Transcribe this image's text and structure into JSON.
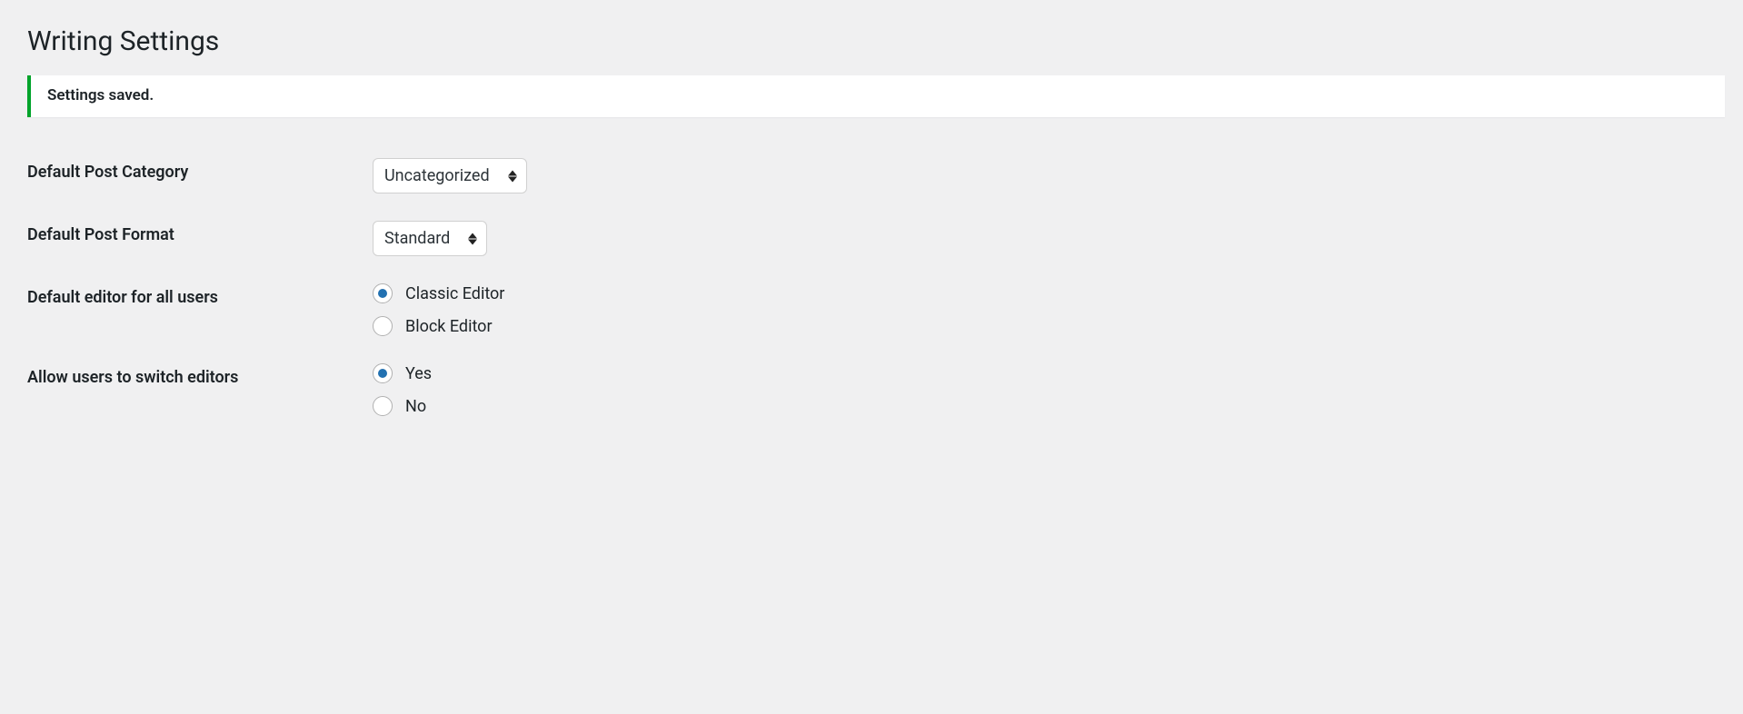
{
  "page_title": "Writing Settings",
  "notice": "Settings saved.",
  "fields": {
    "default_post_category": {
      "label": "Default Post Category",
      "value": "Uncategorized"
    },
    "default_post_format": {
      "label": "Default Post Format",
      "value": "Standard"
    },
    "default_editor": {
      "label": "Default editor for all users",
      "options": {
        "classic": "Classic Editor",
        "block": "Block Editor"
      },
      "selected": "classic"
    },
    "allow_switch": {
      "label": "Allow users to switch editors",
      "options": {
        "yes": "Yes",
        "no": "No"
      },
      "selected": "yes"
    }
  }
}
